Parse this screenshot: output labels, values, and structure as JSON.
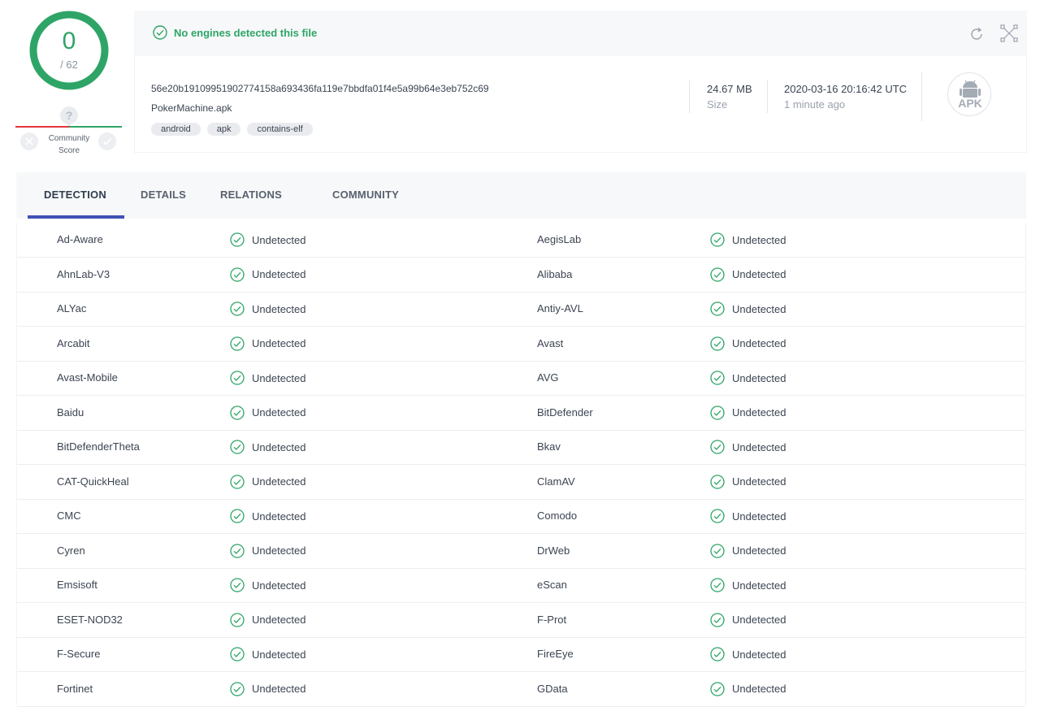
{
  "score": {
    "detected": "0",
    "total": "/ 62",
    "color_ok": "#2ea567"
  },
  "community": {
    "label_line1": "Community",
    "label_line2": "Score",
    "badge": "?"
  },
  "summary": {
    "message": "No engines detected this file"
  },
  "file": {
    "hash": "56e20b19109951902774158a693436fa119e7bbdfa01f4e5a99b64e3eb752c69",
    "name": "PokerMachine.apk",
    "tags": [
      "android",
      "apk",
      "contains-elf"
    ],
    "size_value": "24.67 MB",
    "size_label": "Size",
    "date_value": "2020-03-16 20:16:42 UTC",
    "date_label": "1 minute ago",
    "type_badge": "APK"
  },
  "header_icons": [
    "reanalyze-icon",
    "similar-icon"
  ],
  "tabs": [
    {
      "label": "DETECTION",
      "active": true
    },
    {
      "label": "DETAILS",
      "active": false
    },
    {
      "label": "RELATIONS",
      "active": false
    },
    {
      "label": "COMMUNITY",
      "active": false
    }
  ],
  "detections": [
    {
      "left": {
        "engine": "Ad-Aware",
        "result": "Undetected"
      },
      "right": {
        "engine": "AegisLab",
        "result": "Undetected"
      }
    },
    {
      "left": {
        "engine": "AhnLab-V3",
        "result": "Undetected"
      },
      "right": {
        "engine": "Alibaba",
        "result": "Undetected"
      }
    },
    {
      "left": {
        "engine": "ALYac",
        "result": "Undetected"
      },
      "right": {
        "engine": "Antiy-AVL",
        "result": "Undetected"
      }
    },
    {
      "left": {
        "engine": "Arcabit",
        "result": "Undetected"
      },
      "right": {
        "engine": "Avast",
        "result": "Undetected"
      }
    },
    {
      "left": {
        "engine": "Avast-Mobile",
        "result": "Undetected"
      },
      "right": {
        "engine": "AVG",
        "result": "Undetected"
      }
    },
    {
      "left": {
        "engine": "Baidu",
        "result": "Undetected"
      },
      "right": {
        "engine": "BitDefender",
        "result": "Undetected"
      }
    },
    {
      "left": {
        "engine": "BitDefenderTheta",
        "result": "Undetected"
      },
      "right": {
        "engine": "Bkav",
        "result": "Undetected"
      }
    },
    {
      "left": {
        "engine": "CAT-QuickHeal",
        "result": "Undetected"
      },
      "right": {
        "engine": "ClamAV",
        "result": "Undetected"
      }
    },
    {
      "left": {
        "engine": "CMC",
        "result": "Undetected"
      },
      "right": {
        "engine": "Comodo",
        "result": "Undetected"
      }
    },
    {
      "left": {
        "engine": "Cyren",
        "result": "Undetected"
      },
      "right": {
        "engine": "DrWeb",
        "result": "Undetected"
      }
    },
    {
      "left": {
        "engine": "Emsisoft",
        "result": "Undetected"
      },
      "right": {
        "engine": "eScan",
        "result": "Undetected"
      }
    },
    {
      "left": {
        "engine": "ESET-NOD32",
        "result": "Undetected"
      },
      "right": {
        "engine": "F-Prot",
        "result": "Undetected"
      }
    },
    {
      "left": {
        "engine": "F-Secure",
        "result": "Undetected"
      },
      "right": {
        "engine": "FireEye",
        "result": "Undetected"
      }
    },
    {
      "left": {
        "engine": "Fortinet",
        "result": "Undetected"
      },
      "right": {
        "engine": "GData",
        "result": "Undetected"
      }
    }
  ]
}
